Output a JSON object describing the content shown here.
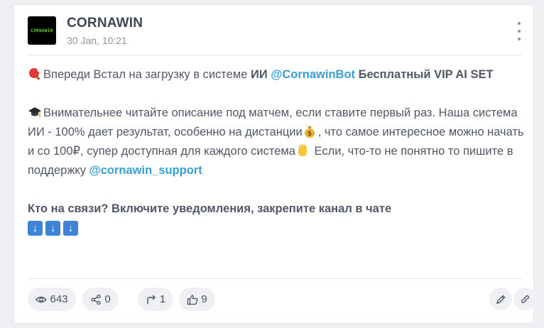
{
  "post": {
    "channel_name": "CORNAWIN",
    "avatar_text": "CORNAWIN",
    "timestamp": "30 Jan, 10:21",
    "line1": {
      "prefix": "Впереди Встал на загрузку в системе ",
      "ai_bold": "ИИ",
      "mention": "@CornawinBot",
      "suffix_bold": " Бесплатный VIP AI SET"
    },
    "line2": {
      "text_a": "Внимательнее читайте описание под матчем, если ставите первый раз. Наша система ИИ - 100% дает результат, особенно на дистанции",
      "text_b": ", что самое интересное можно начать и со 100₽, супер доступная для каждого система",
      "text_c": " Если, что-то не понятно то пишите в поддержку ",
      "mention": "@cornawin_support"
    },
    "line3": {
      "bold_text": "Кто на связи? Включите уведомления, закрепите канал в чате",
      "arrows": [
        "↓",
        "↓",
        "↓"
      ]
    }
  },
  "footer": {
    "views": "643",
    "shares": "0",
    "forwards": "1",
    "likes": "9"
  },
  "icons": {
    "more": "more-vertical-icon",
    "ping_pong": "ping-pong-icon",
    "grad_cap": "graduation-cap-icon",
    "money_bag": "money-bag-icon",
    "hand": "raised-hand-icon",
    "eye": "eye-icon",
    "share": "share-icon",
    "forward": "forward-icon",
    "like": "thumbs-up-icon",
    "edit": "pencil-icon",
    "link": "link-icon"
  },
  "colors": {
    "mention": "#3a9fd0",
    "avatar_bg": "#000000",
    "avatar_text": "#6bd12b",
    "arrow_box": "#3f83d6",
    "pill_bg": "#eef0f4"
  }
}
